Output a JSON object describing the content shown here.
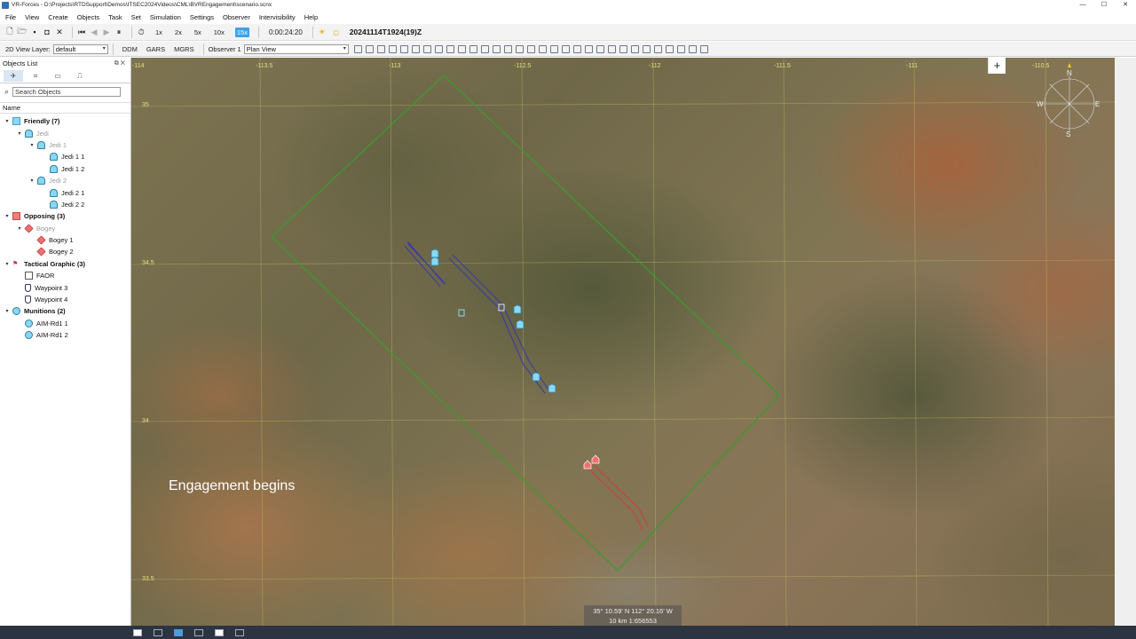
{
  "window": {
    "title": "VR-Forces - D:\\Projects\\RTDSupport\\Demos\\ITSEC2024Videos\\CML\\BVREngagement\\scenario.scnx",
    "controls": [
      "—",
      "☐",
      "✕"
    ]
  },
  "menu": [
    "File",
    "View",
    "Create",
    "Objects",
    "Task",
    "Set",
    "Simulation",
    "Settings",
    "Observer",
    "Intervisibility",
    "Help"
  ],
  "toolbar": {
    "speeds": [
      "1x",
      "2x",
      "5x",
      "10x",
      "15x"
    ],
    "active_speed": "15x",
    "elapsed": "0:00:24:20",
    "datetime": "20241114T1924(19)Z"
  },
  "toolbar2": {
    "layer_label": "2D View Layer:",
    "layer_value": "default",
    "ddm": "DDM",
    "gars": "GARS",
    "mgrs": "MGRS",
    "observer_label": "Observer 1",
    "observer_value": "Plan View"
  },
  "panel": {
    "title": "Objects List",
    "search_placeholder": "Search Objects",
    "column_name": "Name",
    "tree": [
      {
        "label": "Friendly (7)",
        "level": 0,
        "icon": "square-blue",
        "bold": true,
        "toggle": "▾"
      },
      {
        "label": "Jedi",
        "level": 1,
        "icon": "aircraft-blue",
        "dim": true,
        "toggle": "▾"
      },
      {
        "label": "Jedi 1",
        "level": 2,
        "icon": "aircraft-blue",
        "dim": true,
        "toggle": "▾"
      },
      {
        "label": "Jedi 1 1",
        "level": 3,
        "icon": "aircraft-blue"
      },
      {
        "label": "Jedi 1 2",
        "level": 3,
        "icon": "aircraft-blue"
      },
      {
        "label": "Jedi 2",
        "level": 2,
        "icon": "aircraft-blue",
        "dim": true,
        "toggle": "▾"
      },
      {
        "label": "Jedi 2 1",
        "level": 3,
        "icon": "aircraft-blue"
      },
      {
        "label": "Jedi 2 2",
        "level": 3,
        "icon": "aircraft-blue"
      },
      {
        "label": "Opposing (3)",
        "level": 0,
        "icon": "square-red",
        "bold": true,
        "toggle": "▾"
      },
      {
        "label": "Bogey",
        "level": 1,
        "icon": "aircraft-red",
        "dim": true,
        "toggle": "▾"
      },
      {
        "label": "Bogey 1",
        "level": 2,
        "icon": "aircraft-red"
      },
      {
        "label": "Bogey 2",
        "level": 2,
        "icon": "aircraft-red"
      },
      {
        "label": "Tactical Graphic (3)",
        "level": 0,
        "icon": "tactical-graphic",
        "bold": true,
        "toggle": "▾"
      },
      {
        "label": "FAOR",
        "level": 1,
        "icon": "area-box"
      },
      {
        "label": "Waypoint 3",
        "level": 1,
        "icon": "waypoint"
      },
      {
        "label": "Waypoint 4",
        "level": 1,
        "icon": "waypoint"
      },
      {
        "label": "Munitions (2)",
        "level": 0,
        "icon": "munition",
        "bold": true,
        "toggle": "▾"
      },
      {
        "label": "AIM-Rd1 1",
        "level": 1,
        "icon": "munition"
      },
      {
        "label": "AIM-Rd1 2",
        "level": 1,
        "icon": "munition"
      }
    ]
  },
  "map": {
    "caption": "Engagement begins",
    "grid_labels": [
      "-114",
      "-113.5",
      "-113",
      "-112.5",
      "-112",
      "-111.5",
      "-111",
      "-110.5",
      "35",
      "34.5",
      "34",
      "33.5"
    ],
    "compass": {
      "n": "N",
      "e": "E",
      "s": "S",
      "w": "W"
    },
    "coords_line1": "35° 10.59' N  112° 20.16' W",
    "coords_line2": "10 km  1:656553",
    "colors": {
      "friendly_track": "#3a3aa8",
      "opposing_track": "#d23c3c",
      "faor_border": "#3c9a2e",
      "grid": "#c9c36a"
    }
  }
}
